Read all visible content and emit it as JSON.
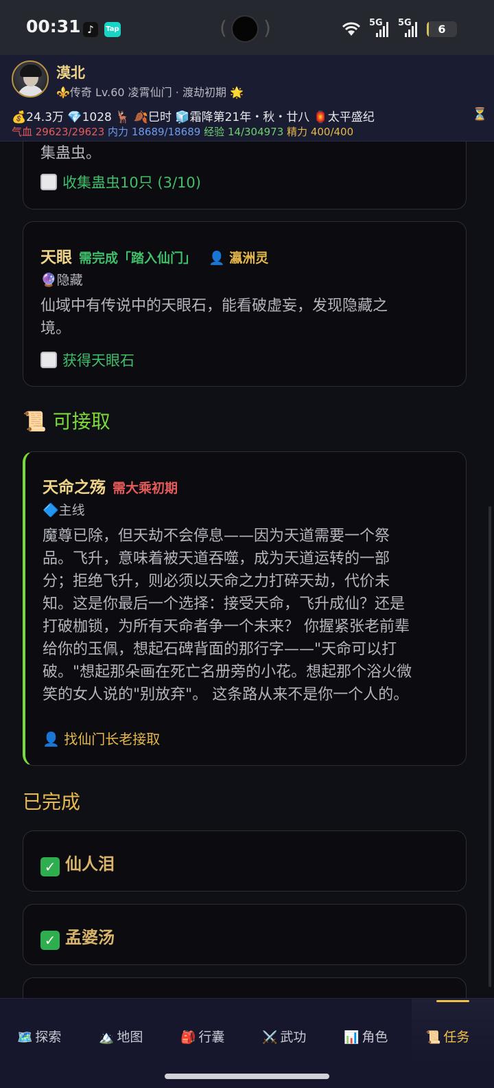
{
  "status_bar": {
    "time": "00:31",
    "app1_icon": "tiktok-icon",
    "app2_label": "Tap",
    "network1": "5G",
    "network2": "5G",
    "battery": "6"
  },
  "player": {
    "name": "漠北",
    "title_line": "⚜️传奇 Lv.60 凌霄仙门 · 渡劫初期 🌟",
    "stats_line": "💰24.3万 💎1028 🦌  🍂巳时 🧊霜降第21年・秋・廿八  🏮太平盛纪",
    "hourglass": "⏳",
    "hp": "气血 29623/29623",
    "mp": "内力 18689/18689",
    "exp": "经验 14/304973",
    "energy": "精力 400/400"
  },
  "quests_active_partial": {
    "desc_tail": "集蛊虫。",
    "objective": "收集蛊虫10只 (3/10)"
  },
  "quest_tianyan": {
    "title": "天眼",
    "requirement": "需完成「踏入仙门」",
    "npc": "👤 瀛洲灵",
    "tag": "🔮隐藏",
    "desc_line1": "仙域中有传说中的天眼石，能看破虚妄，发现隐藏之",
    "desc_line2": "境。",
    "objective": "获得天眼石"
  },
  "available_section": {
    "icon": "📜",
    "label": "可接取"
  },
  "quest_tianming": {
    "title": "天命之殇",
    "requirement": "需大乘初期",
    "tag": "🔷主线",
    "desc_lines": [
      "魔尊已除，但天劫不会停息——因为天道需要一个祭",
      "品。飞升，意味着被天道吞噬，成为天道运转的一部",
      "分；拒绝飞升，则必须以天命之力打碎天劫，代价未",
      "知。这是你最后一个选择：接受天命，飞升成仙？还是",
      "打破枷锁，为所有天命者争一个未来？ 你握紧张老前辈",
      "给你的玉佩，想起石碑背面的那行字——\"天命可以打",
      "破。\"想起那朵画在死亡名册旁的小花。想起那个浴火微",
      "笑的女人说的\"别放弃\"。 这条路从来不是你一个人的。"
    ],
    "accept_hint": "👤 找仙门长老接取"
  },
  "completed_section": {
    "label": "已完成",
    "items": [
      "仙人泪",
      "孟婆汤"
    ]
  },
  "bottom_nav": [
    {
      "icon": "🗺️",
      "label": "探索"
    },
    {
      "icon": "🏔️",
      "label": "地图"
    },
    {
      "icon": "🎒",
      "label": "行囊"
    },
    {
      "icon": "⚔️",
      "label": "武功"
    },
    {
      "icon": "📊",
      "label": "角色"
    },
    {
      "icon": "📜",
      "label": "任务"
    }
  ],
  "colors": {
    "accent_gold": "#f0d488",
    "active_nav": "#f0c24a",
    "objective_green": "#3fbf6a",
    "requirement_red": "#e85b5b",
    "available_green": "#7bd93a"
  }
}
